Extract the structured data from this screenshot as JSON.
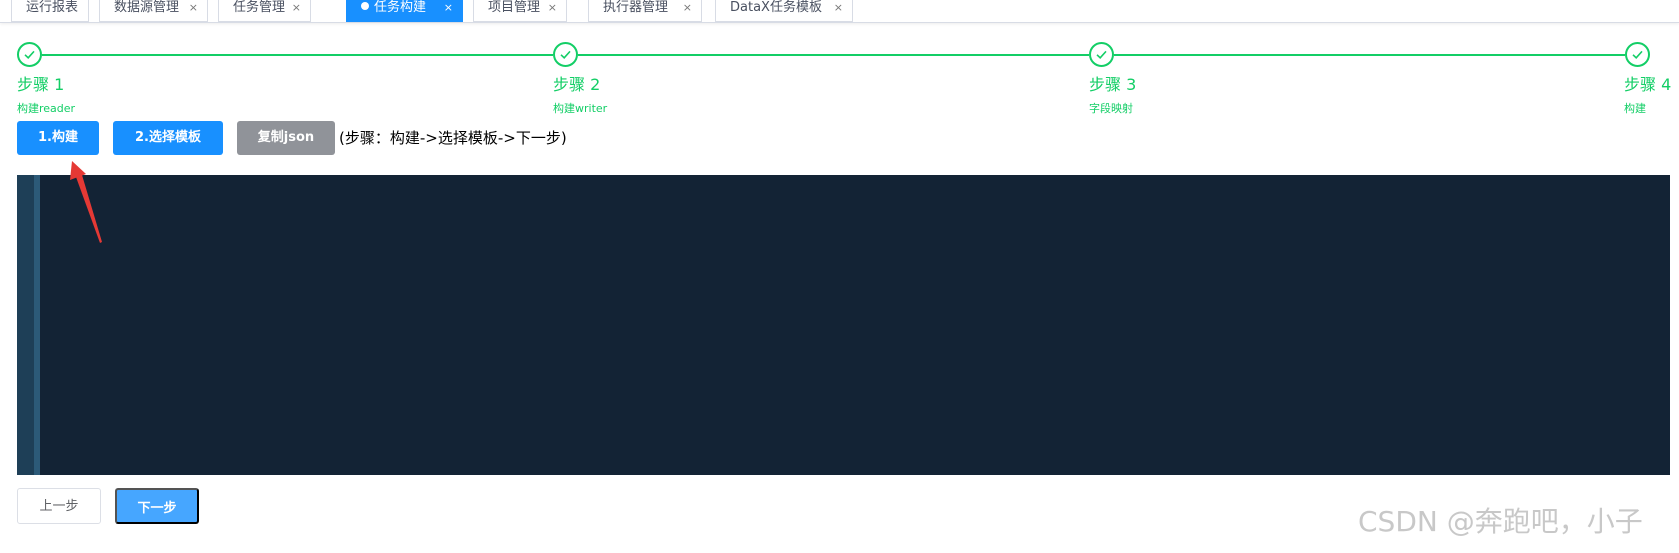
{
  "tabs": [
    {
      "label": "运行报表",
      "active": false
    },
    {
      "label": "数据源管理",
      "close": "×",
      "active": false
    },
    {
      "label": "任务管理",
      "close": "×",
      "active": false
    },
    {
      "label": "任务构建",
      "close": "×",
      "active": true
    },
    {
      "label": "项目管理",
      "close": "×",
      "active": false
    },
    {
      "label": "执行器管理",
      "close": "×",
      "active": false
    },
    {
      "label": "DataX任务模板",
      "close": "×",
      "active": false
    }
  ],
  "steps": [
    {
      "title": "步骤 1",
      "description": "构建reader",
      "status": "success"
    },
    {
      "title": "步骤 2",
      "description": "构建writer",
      "status": "success"
    },
    {
      "title": "步骤 3",
      "description": "字段映射",
      "status": "success"
    },
    {
      "title": "步骤 4",
      "description": "构建",
      "status": "success"
    }
  ],
  "actions": {
    "build": "1.构建",
    "select_template": "2.选择模板",
    "copy_json": "复制json",
    "hint": "(步骤：构建->选择模板->下一步)"
  },
  "navigation": {
    "prev": "上一步",
    "next": "下一步"
  },
  "watermark": "CSDN @奔跑吧，小子",
  "colors": {
    "primary": "#1890ff",
    "success": "#13ce66",
    "editor_bg": "#132335",
    "disabled": "#909399"
  }
}
